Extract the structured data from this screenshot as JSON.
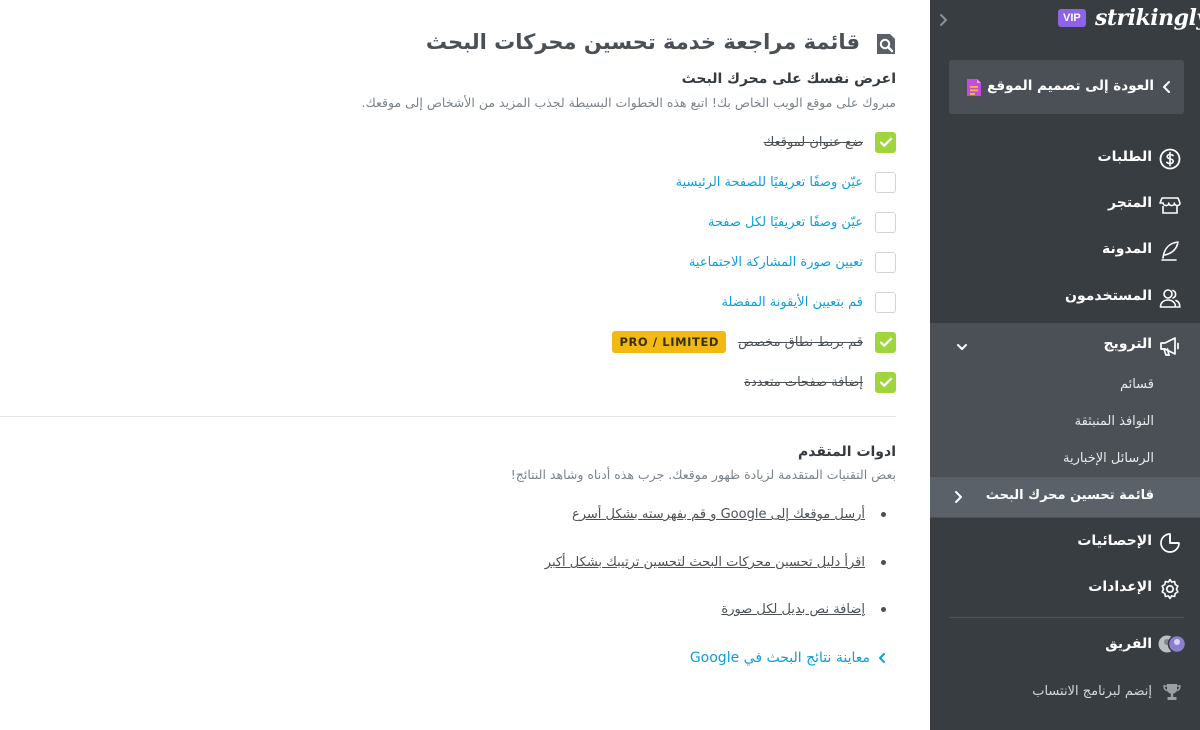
{
  "page": {
    "title": "قائمة مراجعة خدمة تحسين محركات البحث"
  },
  "section_basic": {
    "heading": "اعرض نفسك على محرك البحث",
    "description": "مبروك على موقع الويب الخاص بك! اتبع هذه الخطوات البسيطة لجذب المزيد من الأشخاص إلى موقعك.",
    "items": [
      {
        "label": "ضع عنوان لموقعك",
        "checked": true
      },
      {
        "label": "عيّن وصفًا تعريفيًا للصفحة الرئيسية",
        "checked": false
      },
      {
        "label": "عيّن وصفًا تعريفيًا لكل صفحة",
        "checked": false
      },
      {
        "label": "تعيين صورة المشاركة الاجتماعية",
        "checked": false
      },
      {
        "label": "قم بتعيين الأيقونة المفضلة",
        "checked": false
      },
      {
        "label": "قم بربط نطاق مخصص",
        "checked": true,
        "badge": "PRO / LIMITED"
      },
      {
        "label": "إضافة صفحات متعددة",
        "checked": true
      }
    ]
  },
  "section_advanced": {
    "heading": "ادوات المتقدم",
    "description": "بعض التقنيات المتقدمة لزيادة ظهور موقعك. جرب هذه أدناه وشاهد النتائج!",
    "links": [
      "أرسل موقعك إلى Google و قم بفهرسته بشكل أسرع",
      "اقرأ دليل تحسين محركات البحث لتحسين ترتيبك بشكل أكبر",
      "إضافة نص بديل لكل صورة"
    ],
    "preview_link": "معاينة نتائج البحث في Google"
  },
  "sidebar": {
    "vip_badge": "VIP",
    "brand": "strikingly",
    "back_label": "العودة إلى تصميم الموقع",
    "nav": {
      "orders": "الطلبات",
      "store": "المتجر",
      "blog": "المدونة",
      "users": "المستخدمون",
      "promotion": "الترويج",
      "analytics": "الإحصائيات",
      "settings": "الإعدادات",
      "team": "الفريق",
      "affiliate": "إنضم لبرنامج الانتساب"
    },
    "promotion_sub": {
      "coupons": "قسائم",
      "popups": "النوافذ المنبثقة",
      "newsletters": "الرسائل الإخبارية",
      "seo_checklist": "قائمة تحسين محرك البحث"
    }
  },
  "colors": {
    "accent_link": "#0f9ed8",
    "check_green": "#9fd63b",
    "pro_badge": "#f2b912",
    "sidebar_bg": "#383d42",
    "vip_purple": "#8d63e8"
  },
  "icons": {
    "title": "seo-search-icon",
    "orders": "dollar-circle-icon",
    "store": "storefront-icon",
    "blog": "feather-pen-icon",
    "users": "users-icon",
    "promotion": "megaphone-icon",
    "analytics": "pie-chart-icon",
    "settings": "gear-icon",
    "team": "team-avatars-icon",
    "affiliate": "trophy-icon"
  }
}
